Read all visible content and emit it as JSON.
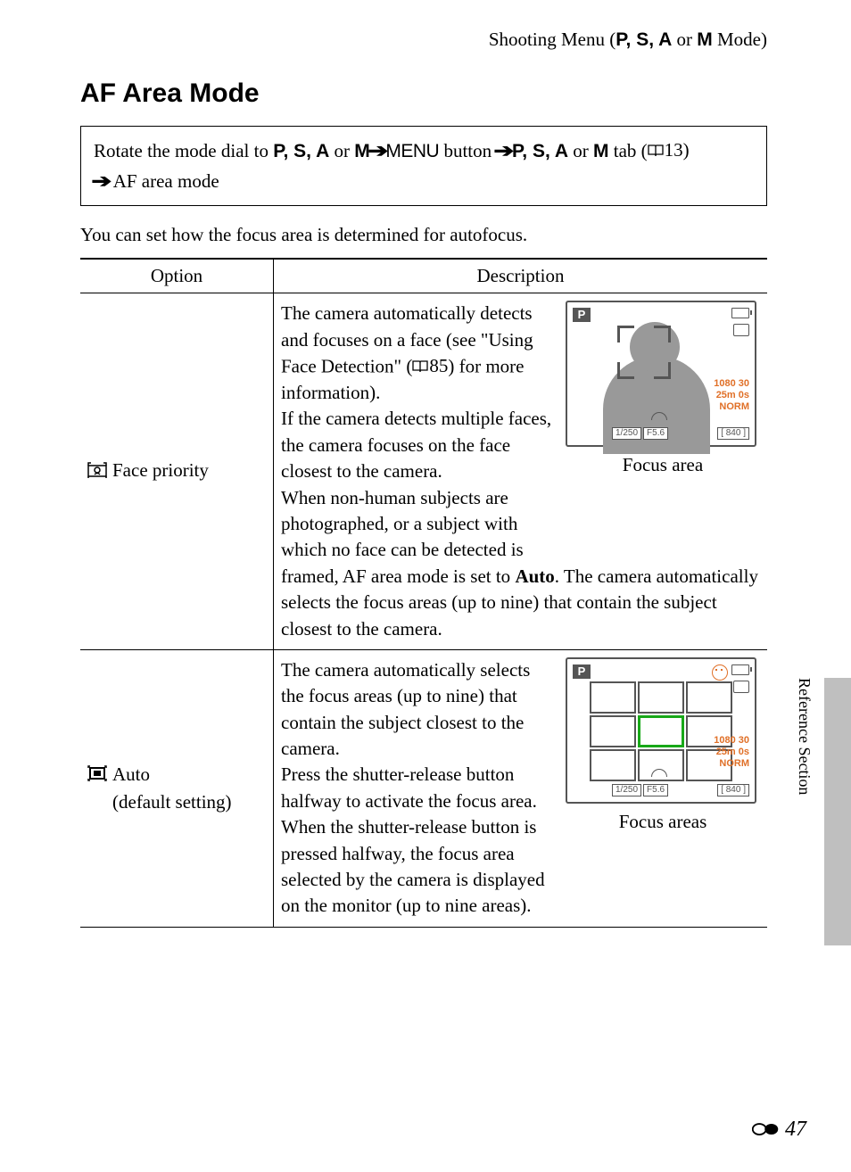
{
  "header": {
    "prefix": "Shooting Menu (",
    "modes": "P, S, A",
    "or": " or ",
    "modeM": "M",
    "suffix": " Mode)"
  },
  "title": "AF Area Mode",
  "nav": {
    "rotate": "Rotate the mode dial to ",
    "modes": "P, S, A",
    "or": " or ",
    "m": "M",
    "arrow": " ➔ ",
    "menu": "MENU",
    "button": " button ",
    "tab": " tab (",
    "ref": "13)",
    "af": " AF area mode"
  },
  "lead": "You can set how the focus area is determined for autofocus.",
  "th": {
    "option": "Option",
    "description": "Description"
  },
  "row1": {
    "option": "Face priority",
    "d1": "The camera automatically detects and focuses on a face (see \"Using Face Detection\" (",
    "ref": "85",
    "d1b": ") for more information).",
    "d2": "If the camera detects multiple faces, the camera focuses on the face closest to the camera.",
    "d3a": "When non-human subjects are photographed, or a subject with which no face can be detected is framed, AF area mode is set to ",
    "d3b": "Auto",
    "d3c": ". The camera automatically selects the focus areas (up to nine) that contain the subject closest to the camera.",
    "caption": "Focus area",
    "lcd": {
      "p": "P",
      "res": "1080 30",
      "time": "25m 0s",
      "norm": "NORM",
      "shutter": "1/250",
      "ap": "F5.6",
      "shots": "840",
      "brk": "["
    }
  },
  "row2": {
    "option": "Auto",
    "option2": "(default setting)",
    "d1": "The camera automatically selects the focus areas (up to nine) that contain the subject closest to the camera.",
    "d2": "Press the shutter-release button halfway to activate the focus area.",
    "d3": "When the shutter-release button is pressed halfway, the focus area selected by the camera is displayed on the monitor (up to nine areas).",
    "caption": "Focus areas",
    "lcd": {
      "p": "P",
      "res": "1080 30",
      "time": "25m 0s",
      "norm": "NORM",
      "shutter": "1/250",
      "ap": "F5.6",
      "shots": "840",
      "brk": "["
    }
  },
  "side": "Reference Section",
  "pagenum": "47"
}
